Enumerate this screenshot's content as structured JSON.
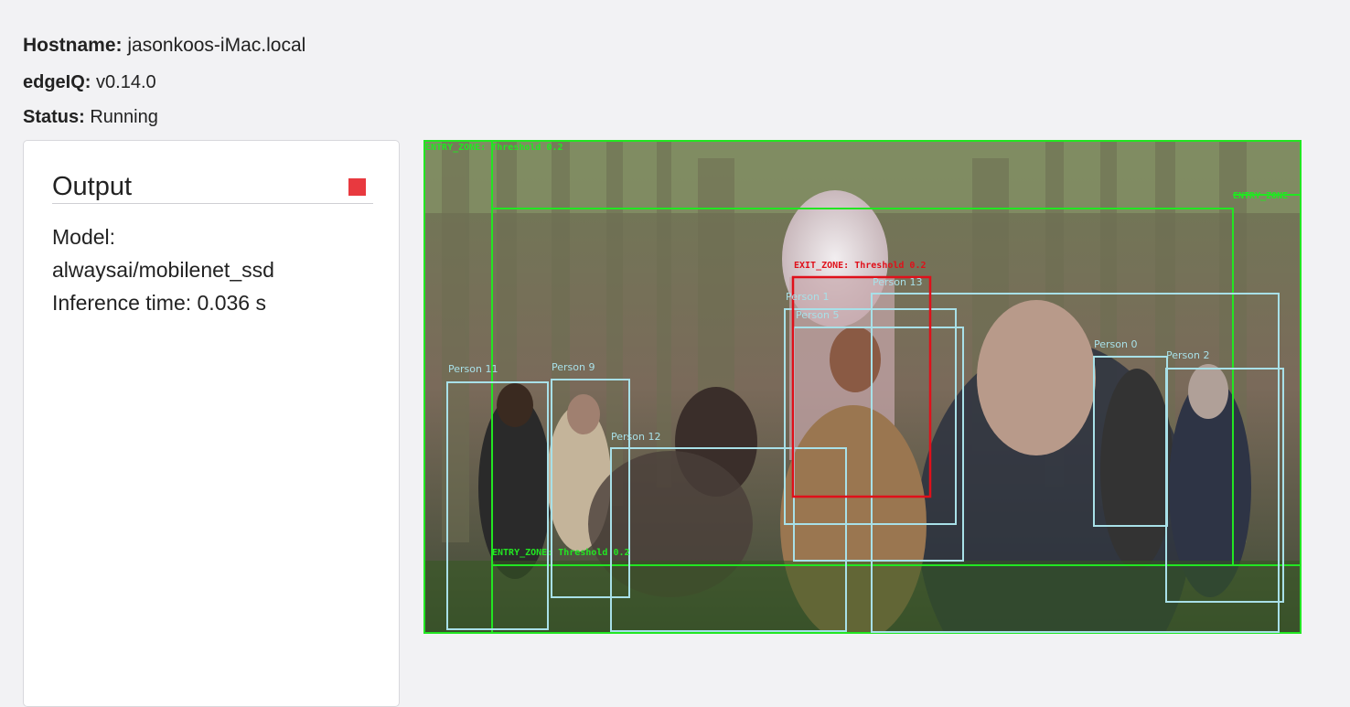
{
  "info": {
    "hostname_label": "Hostname:",
    "hostname_value": "jasonkoos-iMac.local",
    "edgeiq_label": "edgeIQ:",
    "edgeiq_value": "v0.14.0",
    "status_label": "Status:",
    "status_value": "Running"
  },
  "output_panel": {
    "title": "Output",
    "model_label": "Model:",
    "model_name": "alwaysai/mobilenet_ssd",
    "inference_time": "Inference time: 0.036 s"
  },
  "video": {
    "zone_labels": {
      "entry_top": "ENTRY_ZONE: Threshold 0.2",
      "entry_right": "ENTRY_ZONE",
      "exit": "EXIT_ZONE: Threshold 0.2",
      "entry_bottom": "ENTRY_ZONE: Threshold 0.2"
    },
    "person_labels": {
      "p11": "Person 11",
      "p9": "Person 9",
      "p12": "Person 12",
      "p1": "Person 1",
      "p5": "Person 5",
      "p13": "Person 13",
      "p0": "Person 0",
      "p2": "Person 2"
    },
    "colors": {
      "zone_green": "#22e622",
      "exit_red": "#e0101a",
      "person_box": "#a8e0e8",
      "stop_button": "#e8393f"
    }
  }
}
